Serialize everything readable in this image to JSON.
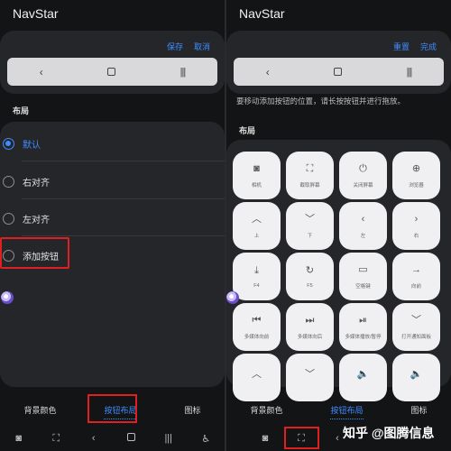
{
  "left": {
    "app_title": "NavStar",
    "top_actions": {
      "save": "保存",
      "cancel": "取消"
    },
    "nav_preview": {
      "back": "‹",
      "home": "□",
      "recents": "|||"
    },
    "section_layout": "布局",
    "radio_options": [
      {
        "label": "默认",
        "selected": true
      },
      {
        "label": "右对齐",
        "selected": false
      },
      {
        "label": "左对齐",
        "selected": false
      },
      {
        "label": "添加按钮",
        "selected": false
      }
    ],
    "bottom_tabs": [
      "背景颜色",
      "按钮布局",
      "图标"
    ],
    "active_tab_index": 1,
    "sys_nav": [
      "camera-icon",
      "screenshot-icon",
      "back-icon",
      "home-icon",
      "recents-icon",
      "accessibility-icon"
    ]
  },
  "right": {
    "app_title": "NavStar",
    "top_actions": {
      "reset": "重置",
      "done": "完成"
    },
    "nav_preview": {
      "back": "‹",
      "home": "□",
      "recents": "|||"
    },
    "hint": "要移动添加按钮的位置，请长按按钮并进行拖放。",
    "section_layout": "布局",
    "grid_buttons": [
      {
        "icon": "camera-icon",
        "glyph": "◙",
        "label": "相机"
      },
      {
        "icon": "screenshot-icon",
        "glyph": "⛶",
        "label": "截取屏幕"
      },
      {
        "icon": "power-icon",
        "glyph": "⏻",
        "label": "关闭屏幕"
      },
      {
        "icon": "globe-icon",
        "glyph": "⊕",
        "label": "浏览器"
      },
      {
        "icon": "chevron-up-icon",
        "glyph": "︿",
        "label": "上"
      },
      {
        "icon": "chevron-down-icon",
        "glyph": "﹀",
        "label": "下"
      },
      {
        "icon": "chevron-left-icon",
        "glyph": "‹",
        "label": "左"
      },
      {
        "icon": "chevron-right-icon",
        "glyph": "›",
        "label": "右"
      },
      {
        "icon": "download-box-icon",
        "glyph": "⤓",
        "label": "F4"
      },
      {
        "icon": "refresh-icon",
        "glyph": "↻",
        "label": "F5"
      },
      {
        "icon": "space-key-icon",
        "glyph": "▭",
        "label": "空格键"
      },
      {
        "icon": "arrow-right-icon",
        "glyph": "→",
        "label": "向前"
      },
      {
        "icon": "skip-previous-icon",
        "glyph": "⏮",
        "label": "多媒体向前"
      },
      {
        "icon": "skip-next-icon",
        "glyph": "⏭",
        "label": "多媒体向后"
      },
      {
        "icon": "play-pause-icon",
        "glyph": "⏯",
        "label": "多媒体播放/暂停"
      },
      {
        "icon": "chevron-down-icon",
        "glyph": "﹀",
        "label": "打开通知面板"
      },
      {
        "icon": "chevron-up-icon",
        "glyph": "︿",
        "label": ""
      },
      {
        "icon": "chevron-down-icon",
        "glyph": "﹀",
        "label": ""
      },
      {
        "icon": "volume-icon",
        "glyph": "🔈",
        "label": ""
      },
      {
        "icon": "volume-icon",
        "glyph": "🔈",
        "label": ""
      }
    ],
    "bottom_tabs": [
      "背景颜色",
      "按钮布局",
      "图标"
    ],
    "active_tab_index": 1,
    "sys_nav": [
      "camera-icon",
      "screenshot-icon",
      "back-icon"
    ],
    "watermark": "知乎 @图腾信息"
  },
  "colors": {
    "accent": "#3f8cff",
    "highlight": "#e02020",
    "card": "#25262a",
    "background": "#131416"
  }
}
